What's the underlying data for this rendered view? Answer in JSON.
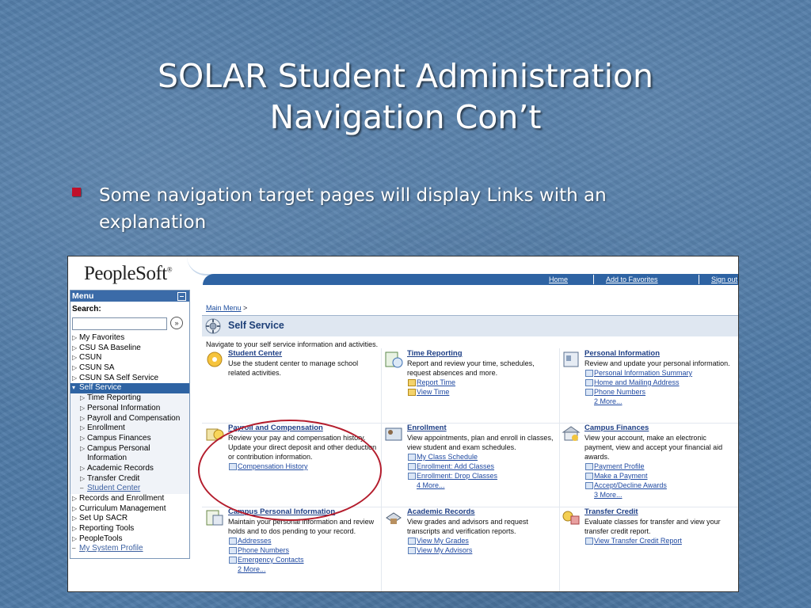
{
  "slide": {
    "title_line1": "SOLAR Student Administration",
    "title_line2": "Navigation Con’t",
    "bullet": "Some navigation target pages will display Links with an explanation"
  },
  "header": {
    "logo": "PeopleSoft",
    "logo_mark": "®",
    "links": [
      "Home",
      "Add to Favorites",
      "Sign out"
    ]
  },
  "menu": {
    "title": "Menu",
    "search_label": "Search:",
    "search_value": "",
    "items": [
      {
        "label": "My Favorites",
        "type": "folder"
      },
      {
        "label": "CSU SA Baseline",
        "type": "folder"
      },
      {
        "label": "CSUN",
        "type": "folder"
      },
      {
        "label": "CSUN SA",
        "type": "folder"
      },
      {
        "label": "CSUN SA Self Service",
        "type": "folder"
      },
      {
        "label": "Self Service",
        "type": "open"
      },
      {
        "label": "Time Reporting",
        "type": "child"
      },
      {
        "label": "Personal Information",
        "type": "child"
      },
      {
        "label": "Payroll and Compensation",
        "type": "child"
      },
      {
        "label": "Enrollment",
        "type": "child"
      },
      {
        "label": "Campus Finances",
        "type": "child"
      },
      {
        "label": "Campus Personal",
        "type": "child"
      },
      {
        "label": "Information",
        "type": "cont"
      },
      {
        "label": "Academic Records",
        "type": "child"
      },
      {
        "label": "Transfer Credit",
        "type": "child"
      },
      {
        "label": "Student Center",
        "type": "childlink"
      },
      {
        "label": "Records and Enrollment",
        "type": "folder"
      },
      {
        "label": "Curriculum Management",
        "type": "folder"
      },
      {
        "label": "Set Up SACR",
        "type": "folder"
      },
      {
        "label": "Reporting Tools",
        "type": "folder"
      },
      {
        "label": "PeopleTools",
        "type": "folder"
      },
      {
        "label": "My System Profile",
        "type": "link"
      }
    ]
  },
  "main": {
    "breadcrumb": "Main Menu",
    "breadcrumb_sep": ">",
    "section_title": "Self Service",
    "section_desc": "Navigate to your self service information and activities.",
    "cells": [
      {
        "title": "Student Center",
        "desc": "Use the student center to manage school related activities.",
        "links": [],
        "more": ""
      },
      {
        "title": "Time Reporting",
        "desc": "Report and review your time, schedules, request absences and more.",
        "links": [
          "Report Time",
          "View Time"
        ],
        "folder": true,
        "more": ""
      },
      {
        "title": "Personal Information",
        "desc": "Review and update your personal information.",
        "links": [
          "Personal Information Summary",
          "Home and Mailing Address",
          "Phone Numbers"
        ],
        "more": "2 More..."
      },
      {
        "title": "Payroll and Compensation",
        "desc": "Review your pay and compensation history. Update your direct deposit and other deduction or contribution information.",
        "links": [
          "Compensation History"
        ],
        "more": ""
      },
      {
        "title": "Enrollment",
        "desc": "View appointments, plan and enroll in classes, view student and exam schedules.",
        "links": [
          "My Class Schedule",
          "Enrollment: Add Classes",
          "Enrollment: Drop Classes"
        ],
        "more": "4 More..."
      },
      {
        "title": "Campus Finances",
        "desc": "View your account, make an electronic payment, view and accept your financial aid awards.",
        "links": [
          "Payment Profile",
          "Make a Payment",
          "Accept/Decline Awards"
        ],
        "more": "3 More..."
      },
      {
        "title": "Campus Personal Information",
        "desc": "Maintain your personal information and review holds and to dos pending to your record.",
        "links": [
          "Addresses",
          "Phone Numbers",
          "Emergency Contacts"
        ],
        "more": "2 More..."
      },
      {
        "title": "Academic Records",
        "desc": "View grades and advisors and request transcripts and verification reports.",
        "links": [
          "View My Grades",
          "View My Advisors"
        ],
        "more": ""
      },
      {
        "title": "Transfer Credit",
        "desc": "Evaluate classes for transfer and view your transfer credit report.",
        "links": [
          "View Transfer Credit Report"
        ],
        "more": ""
      }
    ]
  },
  "colors": {
    "background": "#4f7aa6",
    "bullet": "#c0102a",
    "header_bar": "#2e63a3",
    "highlight_circle": "#b41d2d"
  }
}
